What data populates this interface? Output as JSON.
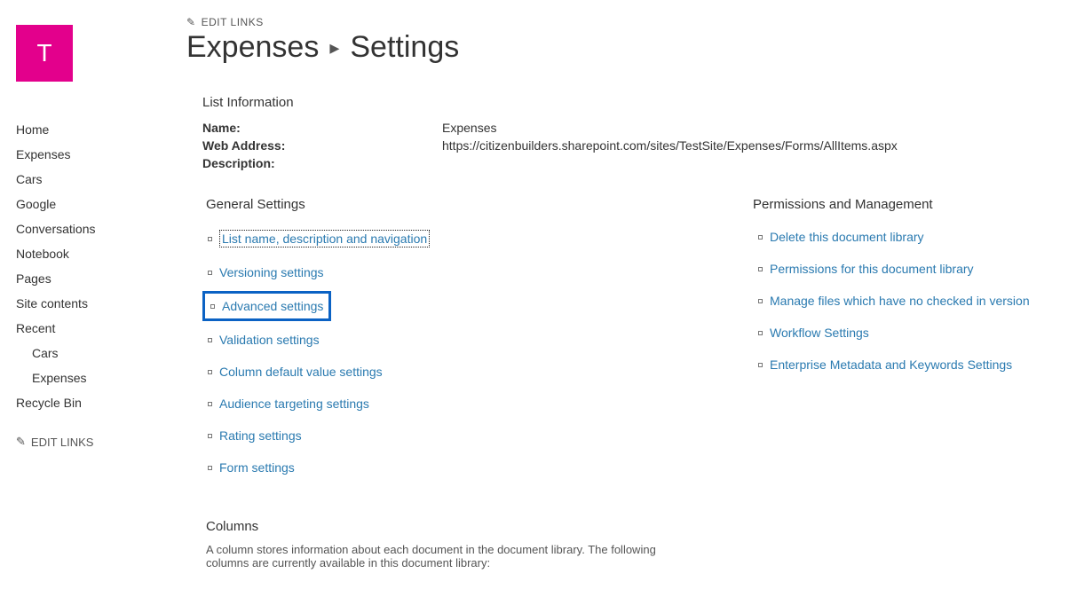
{
  "header": {
    "tile_letter": "T",
    "edit_links_label": "EDIT LINKS",
    "breadcrumb_library": "Expenses",
    "breadcrumb_page": "Settings"
  },
  "nav": {
    "items": [
      {
        "label": "Home"
      },
      {
        "label": "Expenses"
      },
      {
        "label": "Cars"
      },
      {
        "label": "Google"
      },
      {
        "label": "Conversations"
      },
      {
        "label": "Notebook"
      },
      {
        "label": "Pages"
      },
      {
        "label": "Site contents"
      }
    ],
    "recent_label": "Recent",
    "recent_items": [
      {
        "label": "Cars"
      },
      {
        "label": "Expenses"
      }
    ],
    "recycle_label": "Recycle Bin",
    "edit_links_label": "EDIT LINKS"
  },
  "list_info": {
    "heading": "List Information",
    "name_label": "Name:",
    "name_value": "Expenses",
    "address_label": "Web Address:",
    "address_value": "https://citizenbuilders.sharepoint.com/sites/TestSite/Expenses/Forms/AllItems.aspx",
    "description_label": "Description:",
    "description_value": ""
  },
  "general": {
    "heading": "General Settings",
    "links": [
      "List name, description and navigation",
      "Versioning settings",
      "Advanced settings",
      "Validation settings",
      "Column default value settings",
      "Audience targeting settings",
      "Rating settings",
      "Form settings"
    ]
  },
  "permissions": {
    "heading": "Permissions and Management",
    "links": [
      "Delete this document library",
      "Permissions for this document library",
      "Manage files which have no checked in version",
      "Workflow Settings",
      "Enterprise Metadata and Keywords Settings"
    ]
  },
  "columns": {
    "heading": "Columns",
    "description": "A column stores information about each document in the document library. The following columns are currently available in this document library:"
  }
}
